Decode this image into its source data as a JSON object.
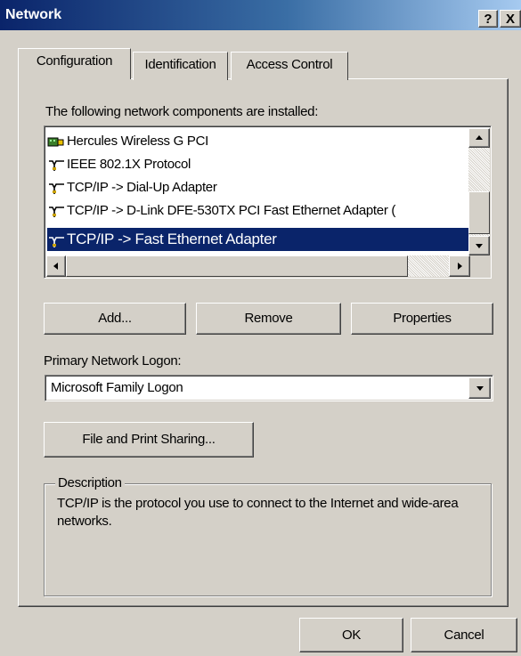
{
  "window": {
    "title": "Network",
    "help_label": "?",
    "close_label": "X"
  },
  "tabs": [
    {
      "label": "Configuration",
      "active": true
    },
    {
      "label": "Identification",
      "active": false
    },
    {
      "label": "Access Control",
      "active": false
    }
  ],
  "components": {
    "label": "The following network components are installed:",
    "items": [
      {
        "label": "Hercules Wireless G PCI",
        "icon": "network-adapter-icon",
        "selected": false
      },
      {
        "label": "IEEE 802.1X Protocol",
        "icon": "protocol-icon",
        "selected": false
      },
      {
        "label": "TCP/IP -> Dial-Up Adapter",
        "icon": "protocol-icon",
        "selected": false
      },
      {
        "label": "TCP/IP -> D-Link DFE-530TX PCI Fast Ethernet Adapter (",
        "icon": "protocol-icon",
        "selected": false
      },
      {
        "label": "TCP/IP -> Fast Ethernet Adapter",
        "icon": "protocol-icon",
        "selected": true
      }
    ]
  },
  "buttons": {
    "add": "Add...",
    "remove": "Remove",
    "properties": "Properties"
  },
  "logon": {
    "label": "Primary Network Logon:",
    "value": "Microsoft Family Logon"
  },
  "sharing": {
    "label": "File and Print Sharing..."
  },
  "description": {
    "title": "Description",
    "text": "TCP/IP is the protocol you use to connect to the Internet and wide-area networks."
  },
  "footer": {
    "ok": "OK",
    "cancel": "Cancel"
  }
}
